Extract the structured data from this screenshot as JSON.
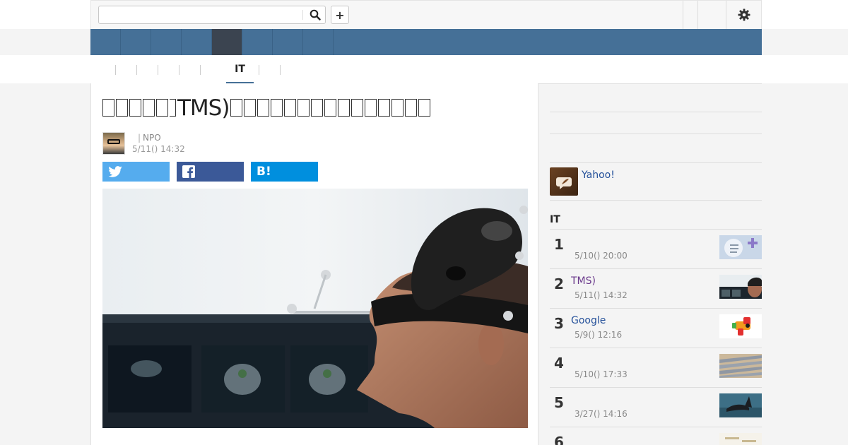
{
  "header": {
    "search_placeholder": "",
    "search_value": "",
    "plus_label": "+",
    "search_icon": "search-icon",
    "gear_icon": "gear-icon"
  },
  "nav": {
    "item_count": 9,
    "active_index": 5
  },
  "subnav": {
    "active_tab": "IT"
  },
  "article": {
    "title_suffix": "TMS)",
    "author_org": "NPO",
    "date": "5/11() 14:32",
    "share": {
      "twitter": "twitter-icon",
      "facebook": "facebook-icon",
      "hatena_label": "B!"
    }
  },
  "sidebar": {
    "yahoo_label": "Yahoo!",
    "ranking_heading": "IT",
    "ranking": [
      {
        "rank": "1",
        "title": "",
        "date": "5/10() 20:00",
        "title_color": "#24509a"
      },
      {
        "rank": "2",
        "title": "TMS)",
        "date": "5/11() 14:32",
        "title_color": "#6b3a8c"
      },
      {
        "rank": "3",
        "title": "Google",
        "date": "5/9() 12:16",
        "title_color": "#24509a"
      },
      {
        "rank": "4",
        "title": "",
        "date": "5/10() 17:33",
        "title_color": "#24509a"
      },
      {
        "rank": "5",
        "title": "",
        "date": "3/27() 14:16",
        "title_color": "#24509a"
      },
      {
        "rank": "6",
        "title": "",
        "date": "",
        "title_color": "#24509a"
      }
    ]
  },
  "colors": {
    "nav_blue": "#457097",
    "nav_active": "#3b4450",
    "twitter": "#55acee",
    "facebook": "#3b5998",
    "hatena": "#008fde",
    "link": "#24509a"
  }
}
